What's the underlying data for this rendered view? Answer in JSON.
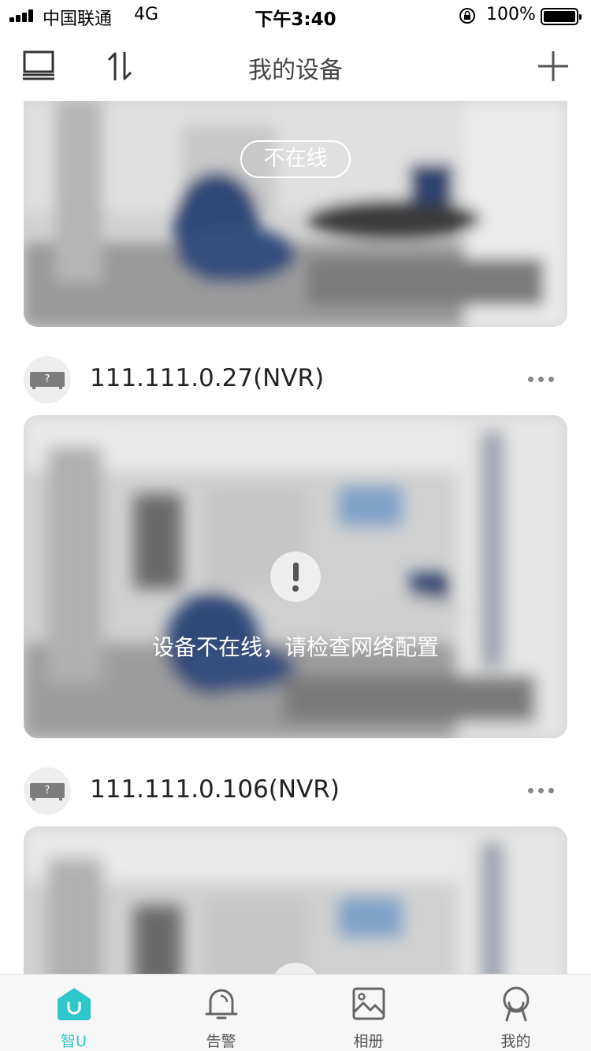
{
  "status_bar": {
    "carrier": "中国联通",
    "network": "4G",
    "time": "下午3:40",
    "battery": "100%"
  },
  "nav": {
    "title": "我的设备",
    "left_icon": "monitor-icon",
    "sort_icon": "sort-arrows-icon",
    "add_icon": "plus-icon"
  },
  "devices": [
    {
      "status_label": "不在线"
    },
    {
      "name": "111.111.0.27(NVR)",
      "icon_text": "?",
      "offline_message": "设备不在线，请检查网络配置"
    },
    {
      "name": "111.111.0.106(NVR)",
      "icon_text": "?"
    }
  ],
  "tabs": [
    {
      "label": "智U",
      "icon": "home-u-icon",
      "active": true
    },
    {
      "label": "告警",
      "icon": "bell-icon",
      "active": false
    },
    {
      "label": "相册",
      "icon": "image-icon",
      "active": false
    },
    {
      "label": "我的",
      "icon": "profile-icon",
      "active": false
    }
  ],
  "colors": {
    "accent": "#2ec7c9",
    "chair": "#2f4a78",
    "preview_bg": "#cfcfcf"
  }
}
